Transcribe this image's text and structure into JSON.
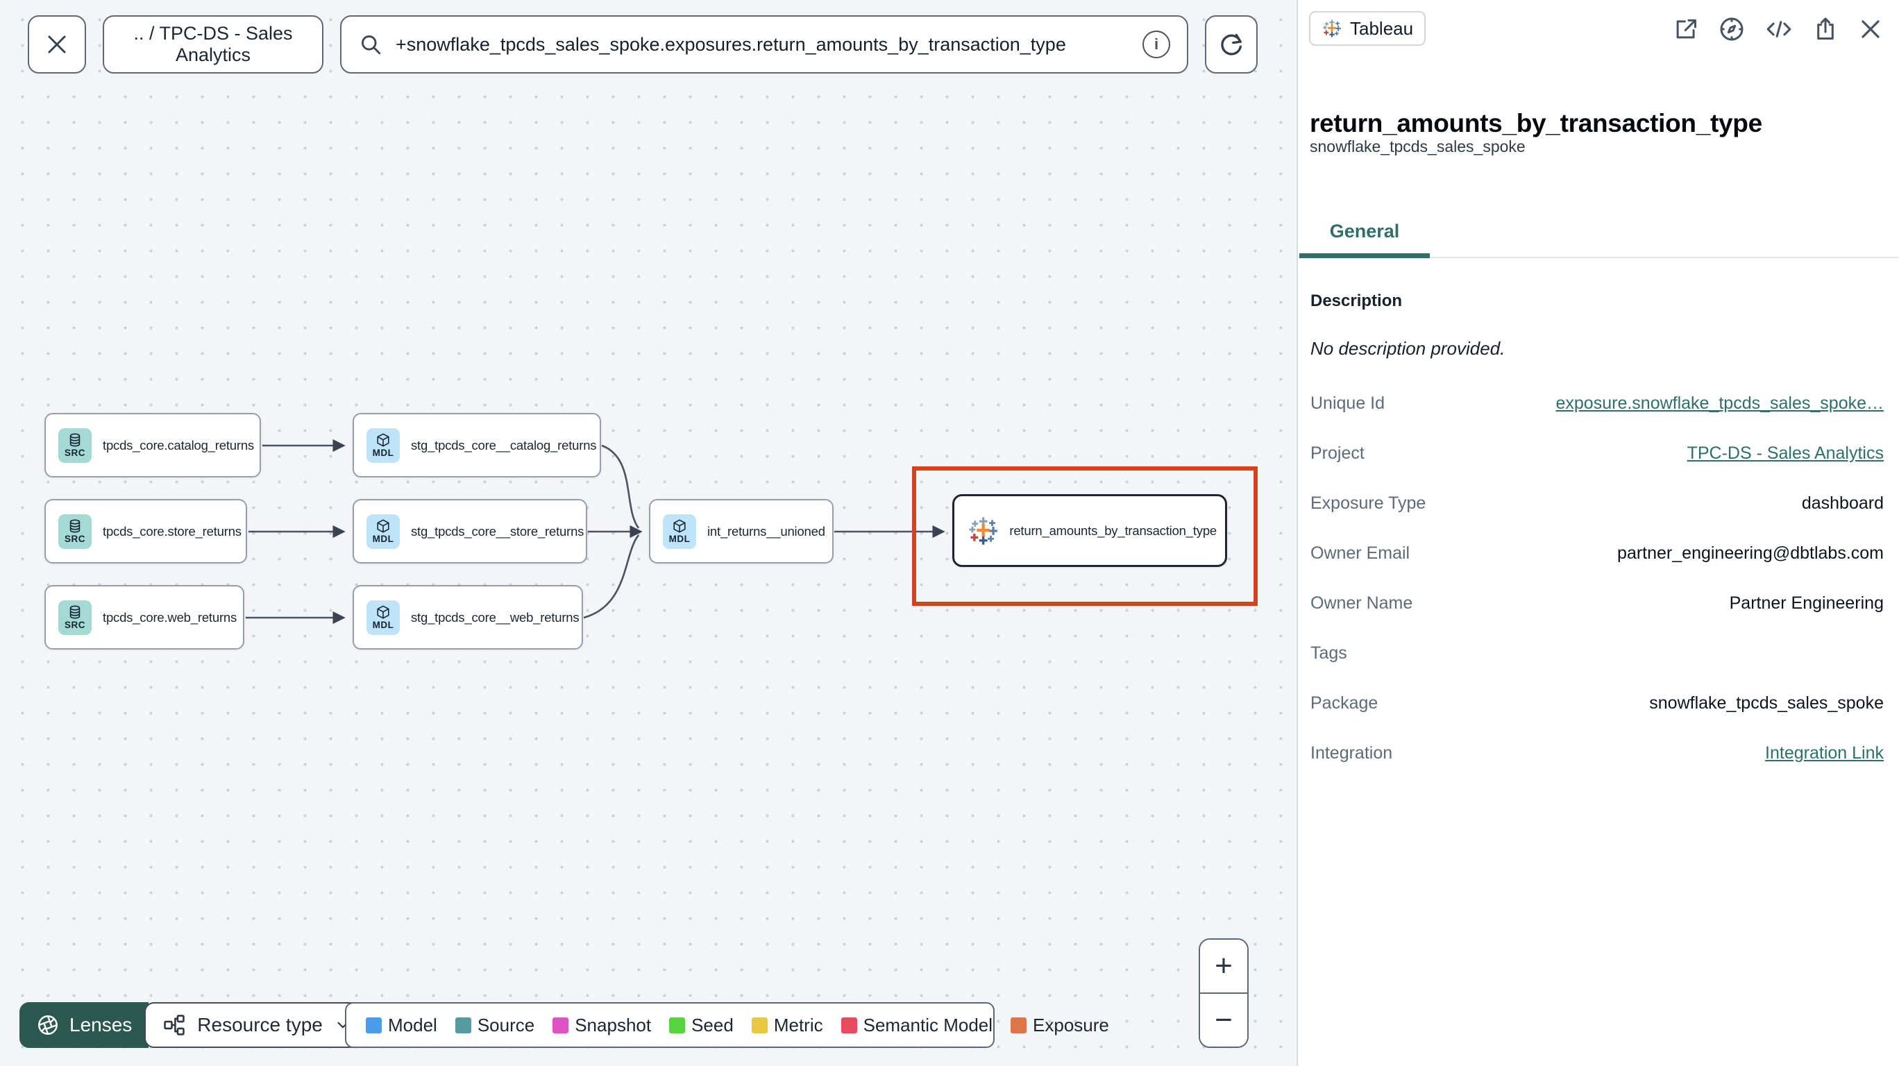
{
  "toolbar": {
    "breadcrumb": ".. / TPC-DS - Sales Analytics",
    "search_value": "+snowflake_tpcds_sales_spoke.exposures.return_amounts_by_transaction_type",
    "info_glyph": "i"
  },
  "graph": {
    "nodes": [
      {
        "badge": "SRC",
        "label": "tpcds_core.catalog_returns"
      },
      {
        "badge": "MDL",
        "label": "stg_tpcds_core__catalog_returns"
      },
      {
        "badge": "SRC",
        "label": "tpcds_core.store_returns"
      },
      {
        "badge": "MDL",
        "label": "stg_tpcds_core__store_returns"
      },
      {
        "badge": "SRC",
        "label": "tpcds_core.web_returns"
      },
      {
        "badge": "MDL",
        "label": "stg_tpcds_core__web_returns"
      },
      {
        "badge": "MDL",
        "label": "int_returns__unioned"
      },
      {
        "label": "return_amounts_by_transaction_type"
      }
    ]
  },
  "controls": {
    "zoom_in": "+",
    "zoom_out": "−",
    "lenses_label": "Lenses",
    "resource_type_label": "Resource type"
  },
  "legend": {
    "items": [
      {
        "label": "Model",
        "color": "#4a9de8"
      },
      {
        "label": "Source",
        "color": "#579ba2"
      },
      {
        "label": "Snapshot",
        "color": "#de50c3"
      },
      {
        "label": "Seed",
        "color": "#57d33d"
      },
      {
        "label": "Metric",
        "color": "#e9c83f"
      },
      {
        "label": "Semantic Model",
        "color": "#e64b60"
      },
      {
        "label": "Exposure",
        "color": "#df7449"
      }
    ]
  },
  "panel": {
    "badge_label": "Tableau",
    "title": "return_amounts_by_transaction_type",
    "subtitle": "snowflake_tpcds_sales_spoke",
    "tab": "General",
    "description_label": "Description",
    "description_empty": "No description provided.",
    "fields": [
      {
        "label": "Unique Id",
        "value": "exposure.snowflake_tpcds_sales_spoke…",
        "link": true
      },
      {
        "label": "Project",
        "value": "TPC-DS - Sales Analytics",
        "link": true
      },
      {
        "label": "Exposure Type",
        "value": "dashboard",
        "link": false
      },
      {
        "label": "Owner Email",
        "value": "partner_engineering@dbtlabs.com",
        "link": false
      },
      {
        "label": "Owner Name",
        "value": "Partner Engineering",
        "link": false
      },
      {
        "label": "Tags",
        "value": "",
        "link": false
      },
      {
        "label": "Package",
        "value": "snowflake_tpcds_sales_spoke",
        "link": false
      },
      {
        "label": "Integration",
        "value": "Integration Link",
        "link": true
      }
    ]
  },
  "colors": {
    "accent_teal": "#2e6f6a",
    "highlight_red": "#d6411f",
    "lenses_green": "#2b584f"
  }
}
